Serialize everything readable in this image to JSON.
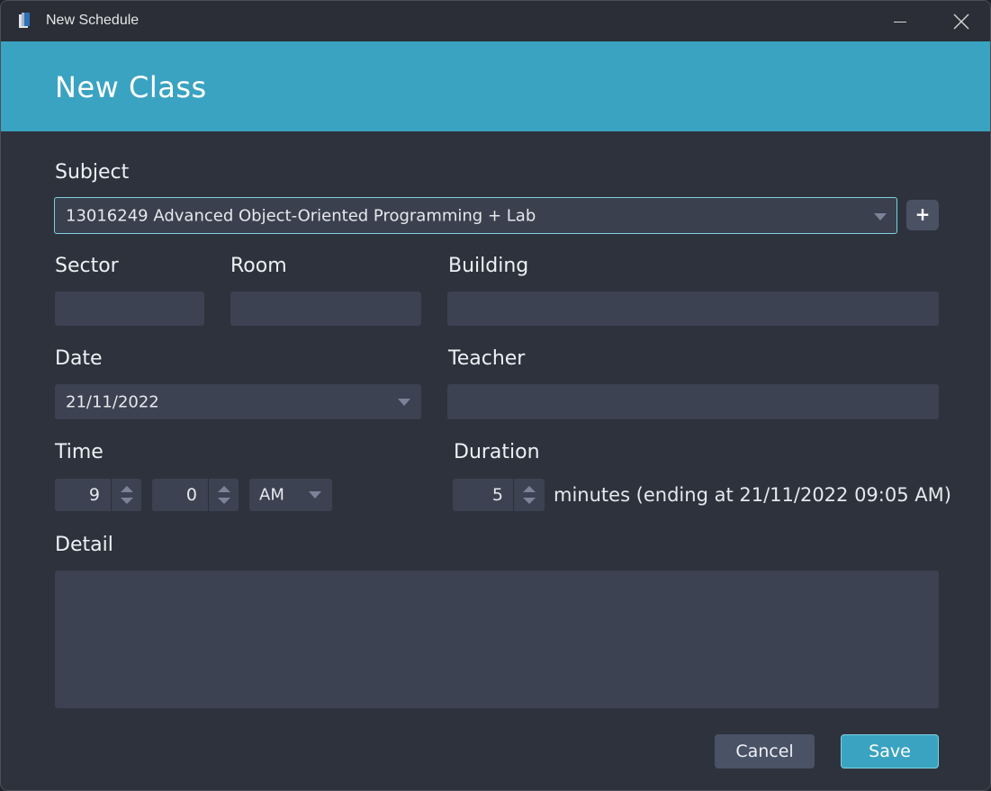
{
  "window": {
    "title": "New Schedule",
    "icons": {
      "app": "app-book-icon",
      "minimize": "minimize-icon",
      "close": "close-icon"
    }
  },
  "header": {
    "title": "New Class"
  },
  "form": {
    "subject": {
      "label": "Subject",
      "value": "13016249 Advanced Object-Oriented Programming + Lab",
      "add_label": "+"
    },
    "sector": {
      "label": "Sector",
      "value": ""
    },
    "room": {
      "label": "Room",
      "value": ""
    },
    "building": {
      "label": "Building",
      "value": ""
    },
    "date": {
      "label": "Date",
      "value": "21/11/2022"
    },
    "teacher": {
      "label": "Teacher",
      "value": ""
    },
    "time": {
      "label": "Time",
      "hour": "9",
      "minute": "0",
      "ampm": "AM"
    },
    "duration": {
      "label": "Duration",
      "value": "5",
      "suffix": "minutes (ending at 21/11/2022 09:05 AM)"
    },
    "detail": {
      "label": "Detail",
      "value": ""
    }
  },
  "buttons": {
    "cancel": "Cancel",
    "save": "Save"
  },
  "colors": {
    "accent": "#3aa3c1",
    "background": "#2e323d",
    "field": "#3c4252"
  }
}
